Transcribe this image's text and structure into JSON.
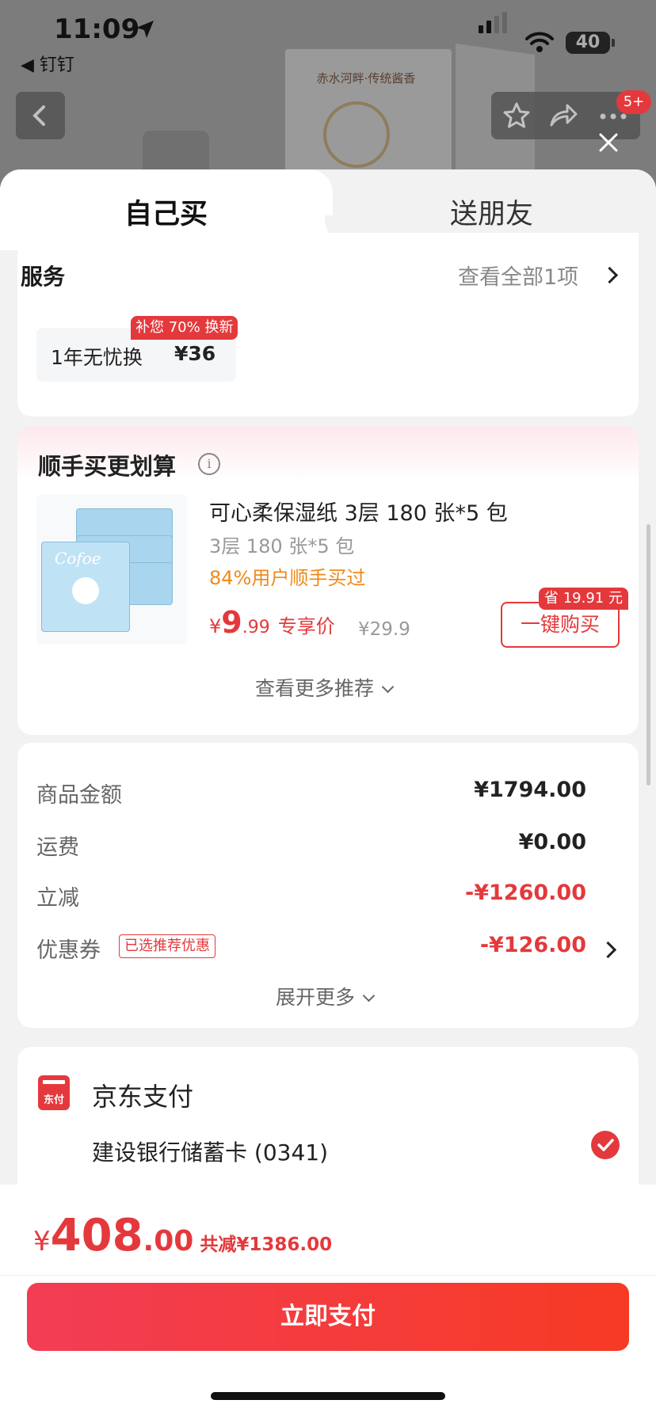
{
  "status_bar": {
    "time": "11:09",
    "back_app": "◀ 钉钉",
    "battery": "40"
  },
  "background": {
    "caption": "赤水河畔·传统酱香",
    "cart_badge": "5+"
  },
  "tabs": {
    "self_buy": "自己买",
    "gift": "送朋友"
  },
  "service": {
    "title": "服务",
    "view_all": "查看全部1项",
    "option_name": "1年无忧换",
    "option_price": "¥36",
    "promo_tag": "补您 70% 换新"
  },
  "addon": {
    "title": "顺手买更划算",
    "product_name": "可心柔保湿纸 3层 180 张*5 包",
    "spec": "3层 180 张*5 包",
    "popularity": "84%用户顺手买过",
    "price_symbol": "¥",
    "price_int": "9",
    "price_dec": ".99",
    "exclusive_label": "专享价",
    "original_price": "¥29.9",
    "buy_button": "一键购买",
    "save_tag": "省 19.91 元",
    "more_recommend": "查看更多推荐",
    "image_logo": "Cofoe"
  },
  "summary": {
    "rows": [
      {
        "label": "商品金额",
        "value": "¥1794.00"
      },
      {
        "label": "运费",
        "value": "¥0.00"
      },
      {
        "label": "立减",
        "value": "-¥1260.00"
      },
      {
        "label": "优惠券",
        "value": "-¥126.00",
        "tag": "已选推荐优惠"
      }
    ],
    "expand_more": "展开更多"
  },
  "payment": {
    "method": "京东支付",
    "icon_label": "东付",
    "card": "建设银行储蓄卡 (0341)"
  },
  "footer": {
    "price_symbol": "¥",
    "price_int": "408",
    "price_dec": ".00",
    "total_saved": "共减¥1386.00",
    "pay_button": "立即支付"
  },
  "colors": {
    "accent": "#e4393c",
    "highlight": "#ee8a1b"
  }
}
